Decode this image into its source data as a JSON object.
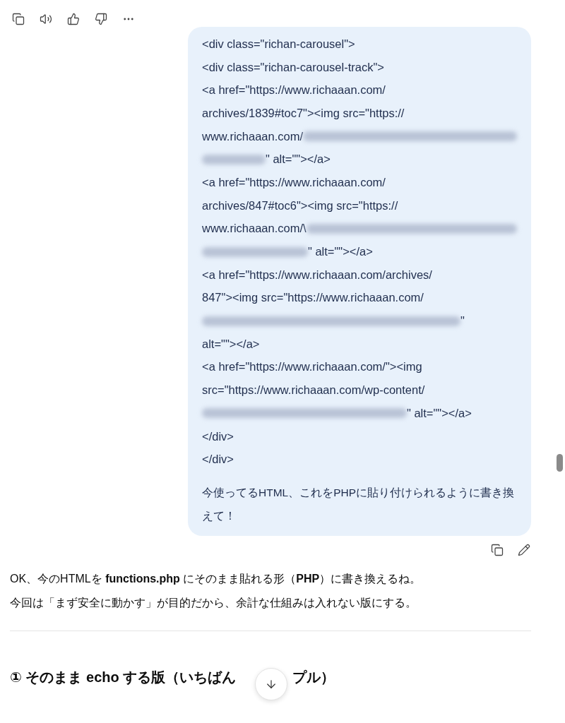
{
  "top_actions": [
    {
      "kind": "copy"
    },
    {
      "kind": "speaker"
    },
    {
      "kind": "thumbs-up"
    },
    {
      "kind": "thumbs-down"
    },
    {
      "kind": "more"
    }
  ],
  "user_message": {
    "code_lines": [
      [
        {
          "kind": "text",
          "text": "<div class=\"richan-carousel\">"
        }
      ],
      [
        {
          "kind": "text",
          "text": "<div class=\"richan-carousel-track\">"
        }
      ],
      [
        {
          "kind": "text",
          "text": "<a href=\"https://www.richaaan.com/"
        }
      ],
      [
        {
          "kind": "text",
          "text": "archives/1839#toc7\"><img src=\"https://"
        }
      ],
      [
        {
          "kind": "text",
          "text": "www.richaaan.com/"
        },
        {
          "kind": "blur_fill"
        }
      ],
      [
        {
          "kind": "blur_short"
        },
        {
          "kind": "text",
          "text": "\" alt=\"\"></a>"
        }
      ],
      [
        {
          "kind": "text",
          "text": "<a href=\"https://www.richaaan.com/"
        }
      ],
      [
        {
          "kind": "text",
          "text": "archives/847#toc6\"><img src=\"https://"
        }
      ],
      [
        {
          "kind": "text",
          "text": "www.richaaan.com/\\"
        },
        {
          "kind": "blur_fill"
        }
      ],
      [
        {
          "kind": "blur_medium"
        },
        {
          "kind": "text",
          "text": "\" alt=\"\"></a>"
        }
      ],
      [
        {
          "kind": "text",
          "text": "<a href=\"https://www.richaaan.com/archives/"
        }
      ],
      [
        {
          "kind": "text",
          "text": "847\"><img src=\"https://www.richaaan.com/"
        }
      ],
      [
        {
          "kind": "blur_long"
        },
        {
          "kind": "text",
          "text": "\""
        }
      ],
      [
        {
          "kind": "text",
          "text": "alt=\"\"></a>"
        }
      ],
      [
        {
          "kind": "text",
          "text": "<a href=\"https://www.richaaan.com/\"><img"
        }
      ],
      [
        {
          "kind": "text",
          "text": "src=\"https://www.richaaan.com/wp-content/"
        }
      ],
      [
        {
          "kind": "blur_wide"
        },
        {
          "kind": "text",
          "text": "\" alt=\"\"></a>"
        }
      ],
      [
        {
          "kind": "text",
          "text": "</div>"
        }
      ],
      [
        {
          "kind": "text",
          "text": "</div>"
        }
      ]
    ],
    "text": "今使ってるHTML、これをPHPに貼り付けられるように書き換えて！"
  },
  "message_actions": [
    {
      "kind": "copy"
    },
    {
      "kind": "edit"
    }
  ],
  "reply": {
    "paragraphs": [
      "OK、今のHTMLを **functions.php** にそのまま貼れる形（**PHP**）に書き換えるね。",
      "今回は「まず安全に動かす」が目的だから、余計な仕組みは入れない版にする。"
    ],
    "heading_parts": [
      "① そのまま echo する版（いちばん",
      "プル）"
    ]
  }
}
